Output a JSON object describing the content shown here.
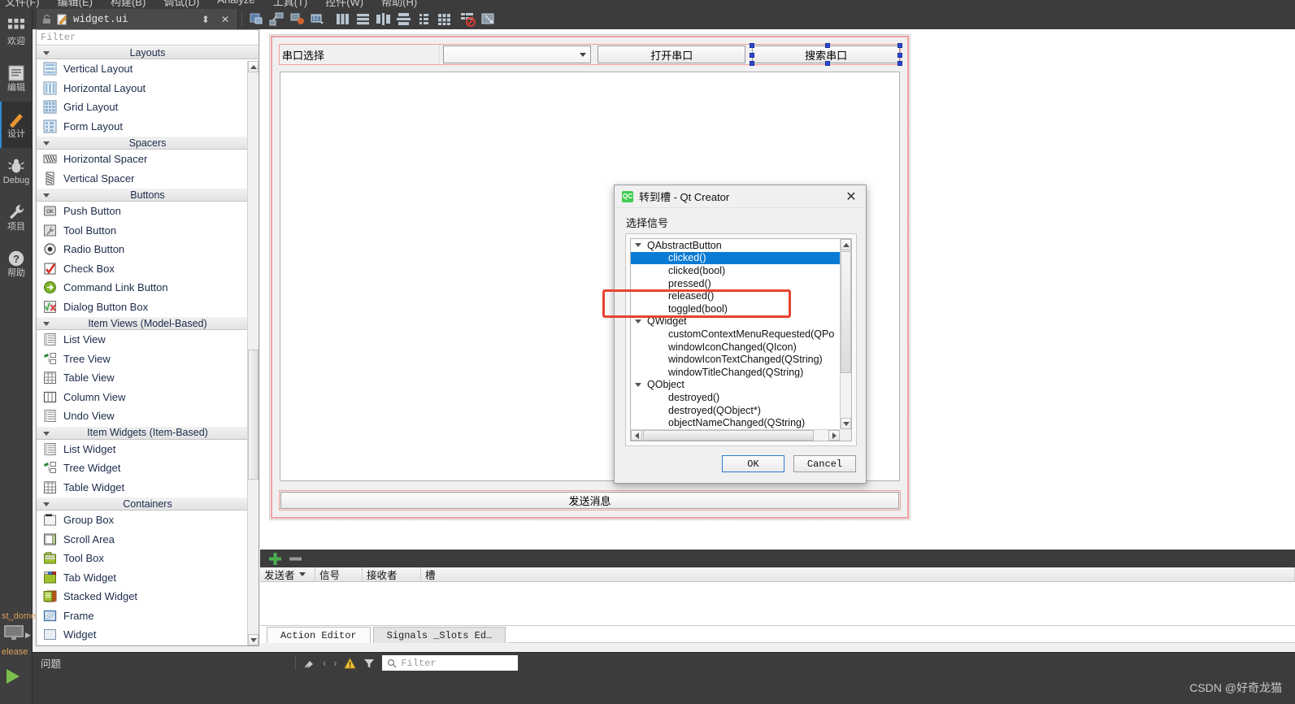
{
  "menubar": {
    "items": [
      "文件(F)",
      "编辑(E)",
      "构建(B)",
      "调试(D)",
      "Analyze",
      "工具(T)",
      "控件(W)",
      "帮助(H)"
    ]
  },
  "editor_tab": {
    "filename": "widget.ui",
    "lock_icon": "unlock-icon",
    "doc_icon": "ui-file-icon",
    "split_icon": "split-editor-icon",
    "close_icon": "close-icon"
  },
  "toolbar": {
    "buttons": [
      {
        "name": "edit-widgets-button",
        "icon": "widget-edit-icon"
      },
      {
        "name": "edit-signals-slots-button",
        "icon": "signal-slot-icon"
      },
      {
        "name": "edit-buddies-button",
        "icon": "buddy-icon"
      },
      {
        "name": "edit-tab-order-button",
        "icon": "tab-order-icon"
      },
      {
        "name": "layout-horizontally-button",
        "icon": "layout-horizontal-icon"
      },
      {
        "name": "layout-vertically-button",
        "icon": "layout-vertical-icon"
      },
      {
        "name": "layout-horizontal-splitter-button",
        "icon": "splitter-horizontal-icon"
      },
      {
        "name": "layout-vertical-splitter-button",
        "icon": "splitter-vertical-icon"
      },
      {
        "name": "layout-form-button",
        "icon": "layout-form-icon"
      },
      {
        "name": "layout-grid-button",
        "icon": "layout-grid-icon"
      },
      {
        "name": "break-layout-button",
        "icon": "break-layout-icon"
      },
      {
        "name": "adjust-size-button",
        "icon": "adjust-size-icon"
      }
    ]
  },
  "modebar": {
    "items": [
      {
        "label": "欢迎",
        "icon": "welcome-grid-icon",
        "active": false
      },
      {
        "label": "编辑",
        "icon": "edit-lines-icon",
        "active": false
      },
      {
        "label": "设计",
        "icon": "design-pencil-icon",
        "active": true
      },
      {
        "label": "Debug",
        "icon": "debug-bug-icon",
        "active": false
      },
      {
        "label": "项目",
        "icon": "projects-wrench-icon",
        "active": false
      },
      {
        "label": "帮助",
        "icon": "help-question-icon",
        "active": false
      }
    ],
    "kit_name": "st_dome",
    "build_config": "elease",
    "target_icon": "desktop-target-icon",
    "run_icon": "run-play-icon"
  },
  "widget_box": {
    "filter_placeholder": "Filter",
    "groups": [
      {
        "title": "Layouts",
        "items": [
          {
            "label": "Vertical Layout",
            "icon": "vertical-layout-icon"
          },
          {
            "label": "Horizontal Layout",
            "icon": "horizontal-layout-icon"
          },
          {
            "label": "Grid Layout",
            "icon": "grid-layout-icon"
          },
          {
            "label": "Form Layout",
            "icon": "form-layout-icon"
          }
        ]
      },
      {
        "title": "Spacers",
        "items": [
          {
            "label": "Horizontal Spacer",
            "icon": "horizontal-spacer-icon"
          },
          {
            "label": "Vertical Spacer",
            "icon": "vertical-spacer-icon"
          }
        ]
      },
      {
        "title": "Buttons",
        "items": [
          {
            "label": "Push Button",
            "icon": "push-button-icon"
          },
          {
            "label": "Tool Button",
            "icon": "tool-button-icon"
          },
          {
            "label": "Radio Button",
            "icon": "radio-button-icon"
          },
          {
            "label": "Check Box",
            "icon": "check-box-icon"
          },
          {
            "label": "Command Link Button",
            "icon": "command-link-button-icon"
          },
          {
            "label": "Dialog Button Box",
            "icon": "dialog-button-box-icon"
          }
        ]
      },
      {
        "title": "Item Views (Model-Based)",
        "items": [
          {
            "label": "List View",
            "icon": "list-view-icon"
          },
          {
            "label": "Tree View",
            "icon": "tree-view-icon"
          },
          {
            "label": "Table View",
            "icon": "table-view-icon"
          },
          {
            "label": "Column View",
            "icon": "column-view-icon"
          },
          {
            "label": "Undo View",
            "icon": "undo-view-icon"
          }
        ]
      },
      {
        "title": "Item Widgets (Item-Based)",
        "items": [
          {
            "label": "List Widget",
            "icon": "list-widget-icon"
          },
          {
            "label": "Tree Widget",
            "icon": "tree-widget-icon"
          },
          {
            "label": "Table Widget",
            "icon": "table-widget-icon"
          }
        ]
      },
      {
        "title": "Containers",
        "items": [
          {
            "label": "Group Box",
            "icon": "group-box-icon"
          },
          {
            "label": "Scroll Area",
            "icon": "scroll-area-icon"
          },
          {
            "label": "Tool Box",
            "icon": "tool-box-icon"
          },
          {
            "label": "Tab Widget",
            "icon": "tab-widget-icon"
          },
          {
            "label": "Stacked Widget",
            "icon": "stacked-widget-icon"
          },
          {
            "label": "Frame",
            "icon": "frame-icon"
          },
          {
            "label": "Widget",
            "icon": "widget-icon"
          }
        ]
      }
    ]
  },
  "form": {
    "serial_label": "串口选择",
    "combo_value": "",
    "open_button": "打开串口",
    "search_button": "搜索串口",
    "send_button": "发送消息"
  },
  "dialog": {
    "title": "转到槽 - Qt Creator",
    "logo_text": "QC",
    "subtitle": "选择信号",
    "ok_label": "OK",
    "cancel_label": "Cancel",
    "selected_signal": "clicked()",
    "tree": [
      {
        "label": "QAbstractButton",
        "type": "group"
      },
      {
        "label": "clicked()",
        "type": "leaf",
        "selected": true
      },
      {
        "label": "clicked(bool)",
        "type": "leaf"
      },
      {
        "label": "pressed()",
        "type": "leaf"
      },
      {
        "label": "released()",
        "type": "leaf"
      },
      {
        "label": "toggled(bool)",
        "type": "leaf"
      },
      {
        "label": "QWidget",
        "type": "group"
      },
      {
        "label": "customContextMenuRequested(QPo",
        "type": "leaf"
      },
      {
        "label": "windowIconChanged(QIcon)",
        "type": "leaf"
      },
      {
        "label": "windowIconTextChanged(QString)",
        "type": "leaf"
      },
      {
        "label": "windowTitleChanged(QString)",
        "type": "leaf"
      },
      {
        "label": "QObject",
        "type": "group"
      },
      {
        "label": "destroyed()",
        "type": "leaf"
      },
      {
        "label": "destroyed(QObject*)",
        "type": "leaf"
      },
      {
        "label": "objectNameChanged(QString)",
        "type": "leaf"
      }
    ]
  },
  "signals_slots_editor": {
    "add_icon": "plus-icon",
    "remove_icon": "minus-icon",
    "columns": [
      "发送者",
      "信号",
      "接收者",
      "槽"
    ],
    "rows": []
  },
  "bottom_tabs": [
    {
      "label": "Action Editor",
      "active": true
    },
    {
      "label": "Signals _Slots Ed…",
      "active": false
    }
  ],
  "statusbar": {
    "label": "问题",
    "filter_placeholder": "Filter",
    "search_icon": "magnifier-icon",
    "warning_icon": "warning-triangle-icon",
    "funnel_icon": "filter-funnel-icon",
    "prev_icon": "chevron-left-icon",
    "next_icon": "chevron-right-icon",
    "clear_icon": "clear-icon"
  },
  "watermark": "CSDN @好奇龙猫",
  "colors": {
    "selection_blue": "#0a7bd4",
    "highlight_red": "#e8432f",
    "form_outline": "#f0a0a0",
    "handle_blue": "#2b4ad6",
    "dark_chrome": "#3c3c3c"
  }
}
